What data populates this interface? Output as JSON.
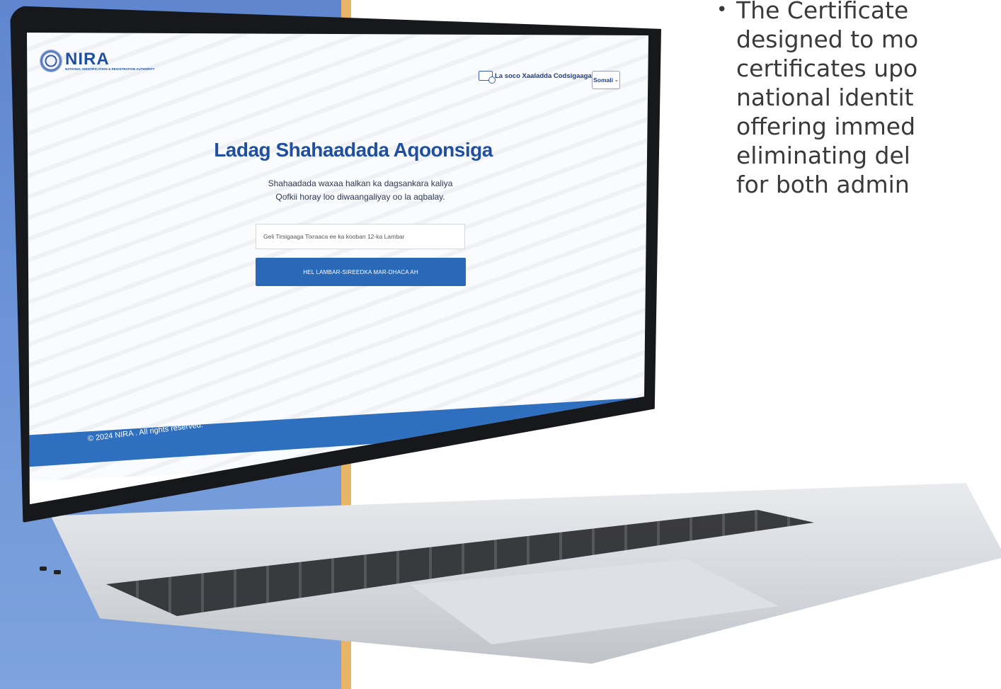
{
  "slide": {
    "text_lines": [
      "The Certificate",
      "designed to mo",
      "certificates upo",
      "national identit",
      "offering immed",
      "eliminating del",
      "for both admin"
    ]
  },
  "site": {
    "logo_name": "NIRA",
    "logo_sub": "NATIONAL IDENTIFICATION & REGISTRATION AUTHORITY",
    "track_label": "La soco Xaaladda Codsigaaga",
    "language": "Somali",
    "title": "Ladag Shahaadada Aqoonsiga",
    "subtitle_line1": "Shahaadada waxaa halkan ka dagsankara kaliya",
    "subtitle_line2": "Qofkii horay loo diwaangaliyay oo la aqbalay.",
    "input_placeholder": "Geli Tirsigaaga Tixraaca ee ka kooban 12-ka Lambar",
    "button_label": "HEL LAMBAR-SIREEDKA MAR-DHACA AH",
    "footer_copy": "© 2024 NIRA . All rights reserved.",
    "icons": {
      "facebook": "facebook-icon",
      "twitter": "twitter-icon"
    }
  },
  "colors": {
    "brand_blue": "#1f4f9e",
    "button_blue": "#2a68b8",
    "footer_blue": "#2f6fbf",
    "slide_blue": "#6e96d8",
    "slide_orange": "#e8b468"
  }
}
